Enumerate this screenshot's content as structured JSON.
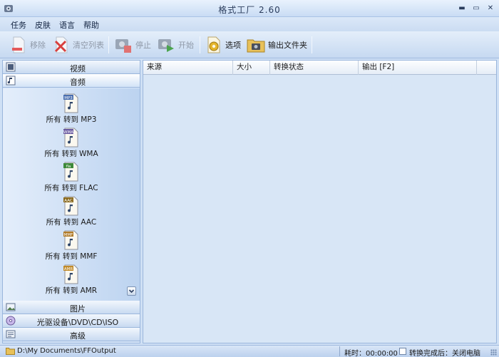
{
  "window": {
    "title": "格式工厂 2.60",
    "min_glyph": "▬",
    "max_glyph": "▭",
    "close_glyph": "✕"
  },
  "menu": {
    "items": [
      "任务",
      "皮肤",
      "语言",
      "帮助"
    ]
  },
  "toolbar": {
    "remove": "移除",
    "clear_list": "清空列表",
    "stop": "停止",
    "start": "开始",
    "options": "选项",
    "output_folder": "输出文件夹"
  },
  "sidebar": {
    "categories": {
      "video": "视频",
      "audio": "音频",
      "picture": "图片",
      "rom": "光驱设备\\DVD\\CD\\ISO",
      "advanced": "高级"
    },
    "audio_formats": [
      {
        "label": "所有 转到 MP3",
        "badge": "MP3",
        "icon": "mp3-file-icon"
      },
      {
        "label": "所有 转到 WMA",
        "badge": "WMA",
        "icon": "wma-file-icon"
      },
      {
        "label": "所有 转到 FLAC",
        "badge": "fla",
        "icon": "flac-file-icon"
      },
      {
        "label": "所有 转到 AAC",
        "badge": "AAC",
        "icon": "aac-file-icon"
      },
      {
        "label": "所有 转到 MMF",
        "badge": "MMF",
        "icon": "mmf-file-icon"
      },
      {
        "label": "所有 转到 AMR",
        "badge": "AMR",
        "icon": "amr-file-icon"
      }
    ]
  },
  "table": {
    "columns": [
      "来源",
      "大小",
      "转换状态",
      "输出 [F2]"
    ]
  },
  "status": {
    "path": "D:\\My Documents\\FFOutput",
    "elapsed": "耗时：00:00:00",
    "after_done": "转换完成后：关闭电脑"
  },
  "colors": {
    "accent": "#3a6fc0",
    "panel": "#d6e5f8"
  }
}
